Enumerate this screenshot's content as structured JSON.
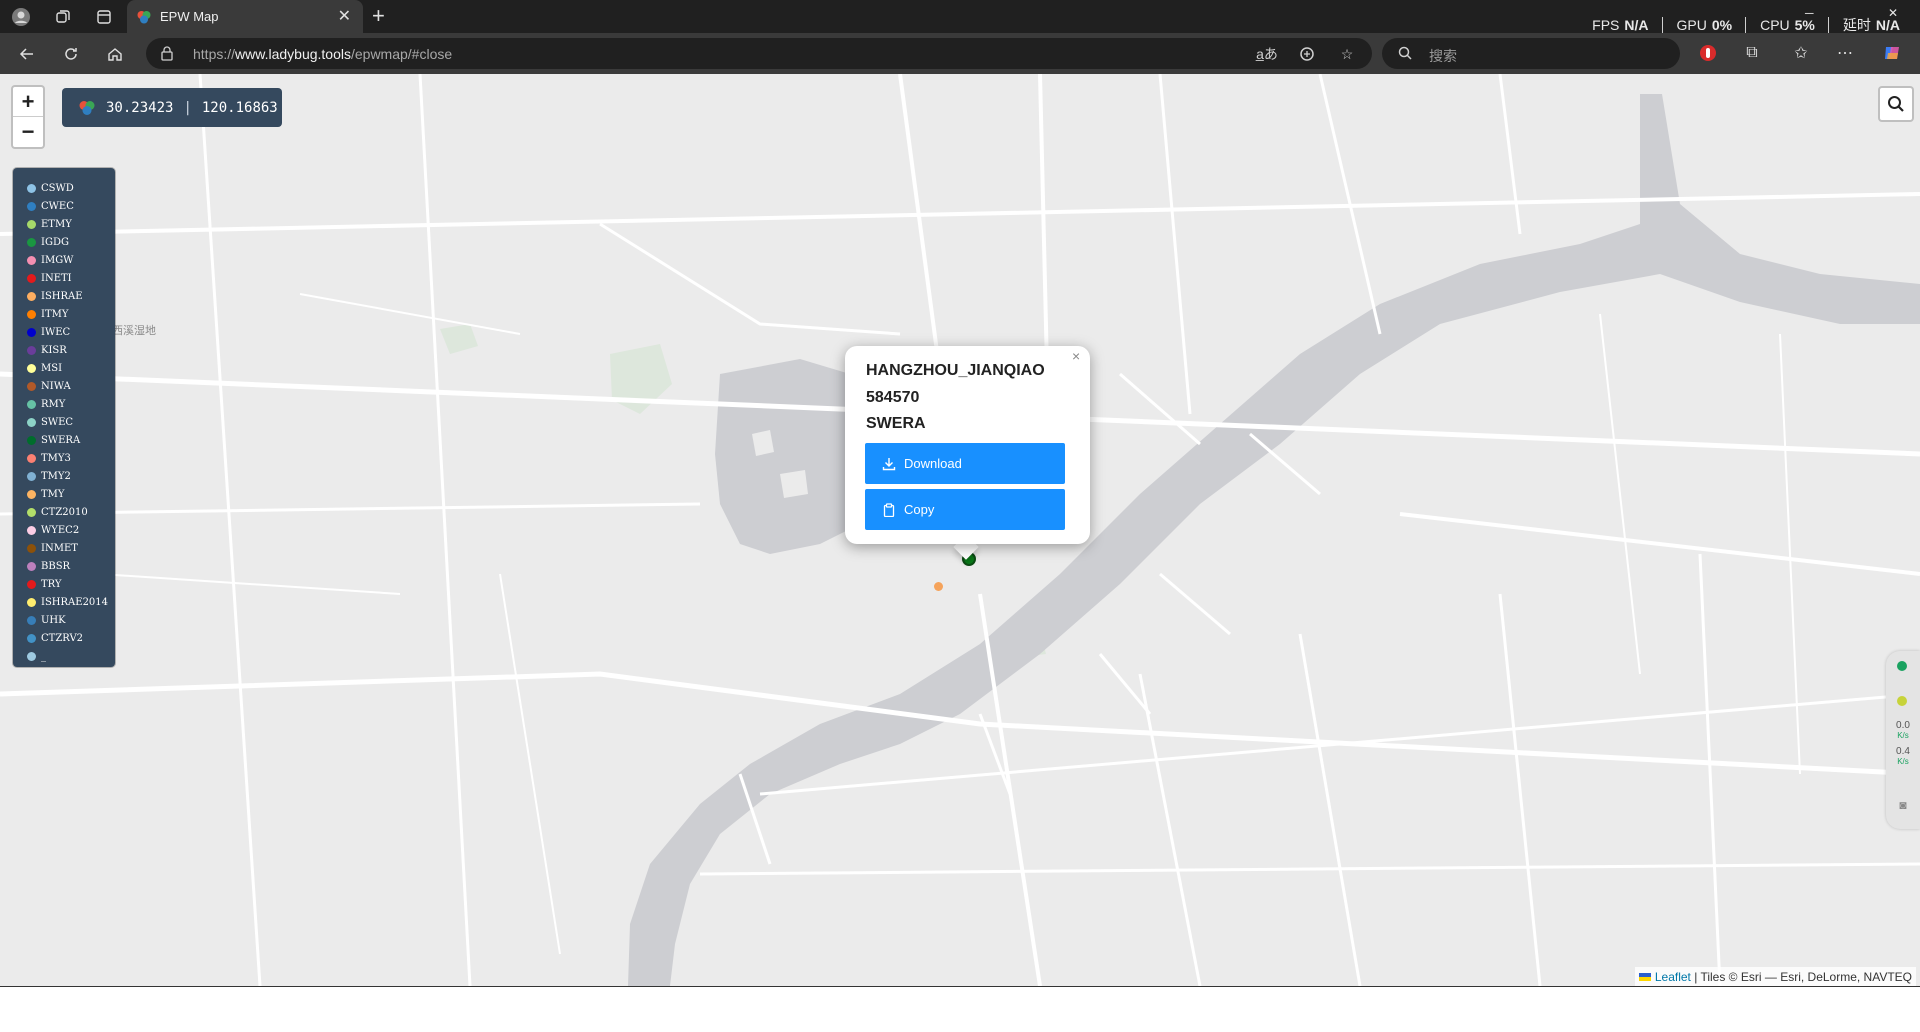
{
  "browser": {
    "tab_title": "EPW Map",
    "url_scheme": "https://",
    "url_host": "www.ladybug.tools",
    "url_path": "/epwmap/#close",
    "search_placeholder": "搜索",
    "perf": [
      {
        "label": "FPS",
        "value": "N/A"
      },
      {
        "label": "GPU",
        "value": "0%"
      },
      {
        "label": "CPU",
        "value": "5%"
      },
      {
        "label": "延时",
        "value": "N/A"
      }
    ]
  },
  "map": {
    "coordinates": {
      "lat": "30.23423",
      "lng": "120.16863"
    },
    "zoom_in_label": "+",
    "zoom_out_label": "−",
    "background_label": "西溪湿地",
    "legend": [
      {
        "label": "CSWD",
        "color": "#8ec3e6"
      },
      {
        "label": "CWEC",
        "color": "#2f7fc1"
      },
      {
        "label": "ETMY",
        "color": "#a6d96a"
      },
      {
        "label": "IGDG",
        "color": "#1a9641"
      },
      {
        "label": "IMGW",
        "color": "#f48fb1"
      },
      {
        "label": "INETI",
        "color": "#e31a1c"
      },
      {
        "label": "ISHRAE",
        "color": "#fdae61"
      },
      {
        "label": "ITMY",
        "color": "#ff7f00"
      },
      {
        "label": "IWEC",
        "color": "#0000cc"
      },
      {
        "label": "KISR",
        "color": "#6a3d9a"
      },
      {
        "label": "MSI",
        "color": "#ffff99"
      },
      {
        "label": "NIWA",
        "color": "#b15928"
      },
      {
        "label": "RMY",
        "color": "#66c2a5"
      },
      {
        "label": "SWEC",
        "color": "#8dd3c7"
      },
      {
        "label": "SWERA",
        "color": "#006d2c"
      },
      {
        "label": "TMY3",
        "color": "#fb8072"
      },
      {
        "label": "TMY2",
        "color": "#80b1d3"
      },
      {
        "label": "TMY",
        "color": "#fdb462"
      },
      {
        "label": "CTZ2010",
        "color": "#b3de69"
      },
      {
        "label": "WYEC2",
        "color": "#fccde5"
      },
      {
        "label": "INMET",
        "color": "#8c510a"
      },
      {
        "label": "BBSR",
        "color": "#bc80bd"
      },
      {
        "label": "TRY",
        "color": "#e41a1c"
      },
      {
        "label": "ISHRAE2014",
        "color": "#ffed6f"
      },
      {
        "label": "UHK",
        "color": "#377eb8"
      },
      {
        "label": "CTZRV2",
        "color": "#4292c6"
      },
      {
        "label": "_",
        "color": "#9ecae1"
      }
    ],
    "popup": {
      "station_name": "HANGZHOU_JIANQIAO",
      "station_id": "584570",
      "source": "SWERA",
      "download_label": "Download",
      "copy_label": "Copy",
      "close_label": "×"
    },
    "attribution": {
      "leaflet": "Leaflet",
      "tiles": "| Tiles © Esri — Esri, DeLorme, NAVTEQ"
    },
    "side_widget": {
      "rate_up": "0.0",
      "rate_down": "0.4",
      "unit": "K/s"
    }
  }
}
